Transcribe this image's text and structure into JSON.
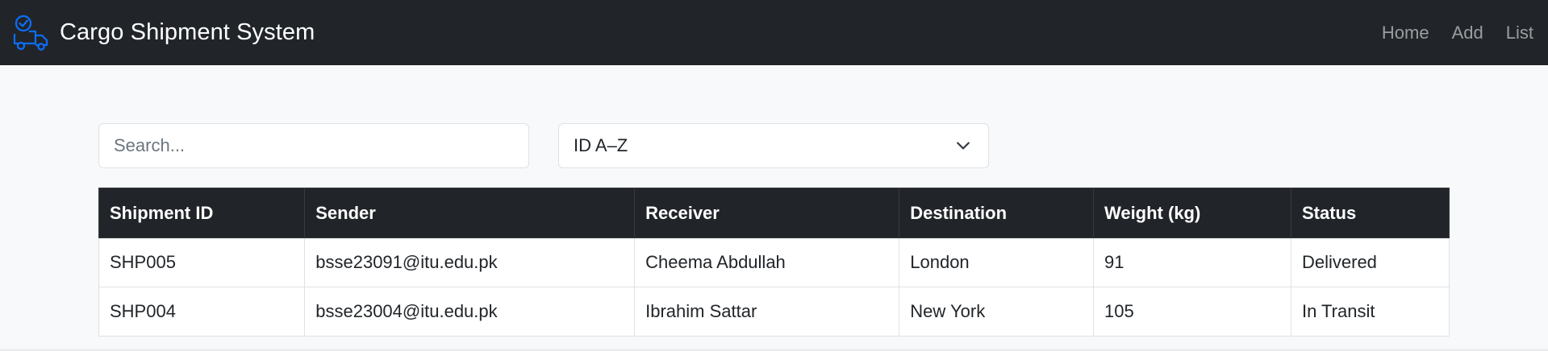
{
  "navbar": {
    "brand_title": "Cargo Shipment System",
    "links": [
      {
        "label": "Home"
      },
      {
        "label": "Add"
      },
      {
        "label": "List"
      }
    ]
  },
  "filters": {
    "search_placeholder": "Search...",
    "search_value": "",
    "sort_selected": "ID A–Z"
  },
  "table": {
    "headers": [
      "Shipment ID",
      "Sender",
      "Receiver",
      "Destination",
      "Weight (kg)",
      "Status"
    ],
    "rows": [
      [
        "SHP005",
        "bsse23091@itu.edu.pk",
        "Cheema Abdullah",
        "London",
        "91",
        "Delivered"
      ],
      [
        "SHP004",
        "bsse23004@itu.edu.pk",
        "Ibrahim Sattar",
        "New York",
        "105",
        "In Transit"
      ]
    ]
  },
  "colors": {
    "navbar_bg": "#212529",
    "page_bg": "#f8f9fa",
    "logo_accent": "#0d6efd"
  },
  "icons": {
    "brand": "truck-check-icon",
    "sort": "chevron-down-icon"
  }
}
